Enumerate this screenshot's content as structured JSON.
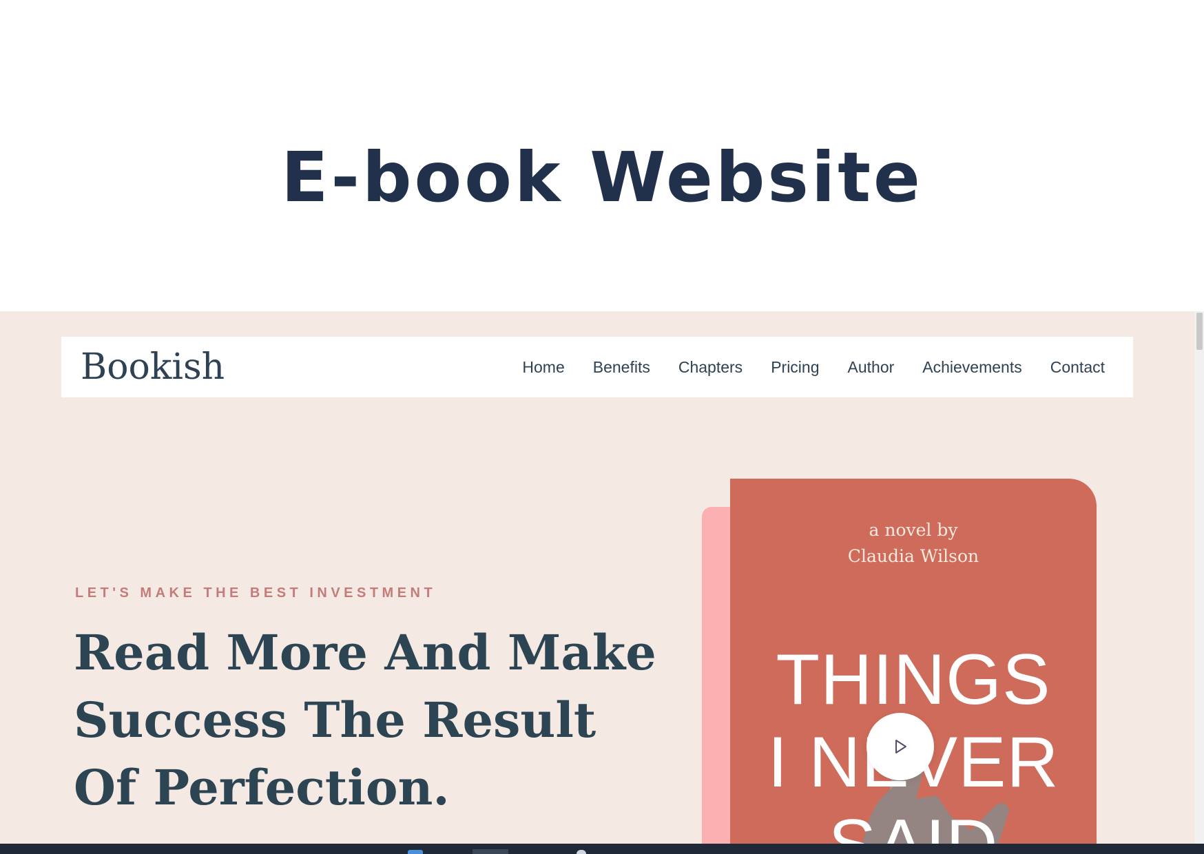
{
  "page": {
    "title": "E-book Website"
  },
  "site": {
    "logo": "Bookish",
    "nav": [
      "Home",
      "Benefits",
      "Chapters",
      "Pricing",
      "Author",
      "Achievements",
      "Contact"
    ],
    "hero": {
      "eyebrow": "LET'S MAKE THE BEST INVESTMENT",
      "headline_lines": [
        "Read More And Make",
        "Success The Result",
        "Of Perfection."
      ]
    },
    "book": {
      "byline_1": "a novel by",
      "byline_2": "Claudia Wilson",
      "title_1": "THINGS",
      "title_2": "I NEVER",
      "title_3": "SAID"
    }
  },
  "icons": {
    "play": "play-icon"
  },
  "colors": {
    "background": "#f4e9e3",
    "accent": "#c47c7a",
    "heading": "#2d4453",
    "book": "#cf6b5a",
    "book_back": "#fbb0b2"
  }
}
